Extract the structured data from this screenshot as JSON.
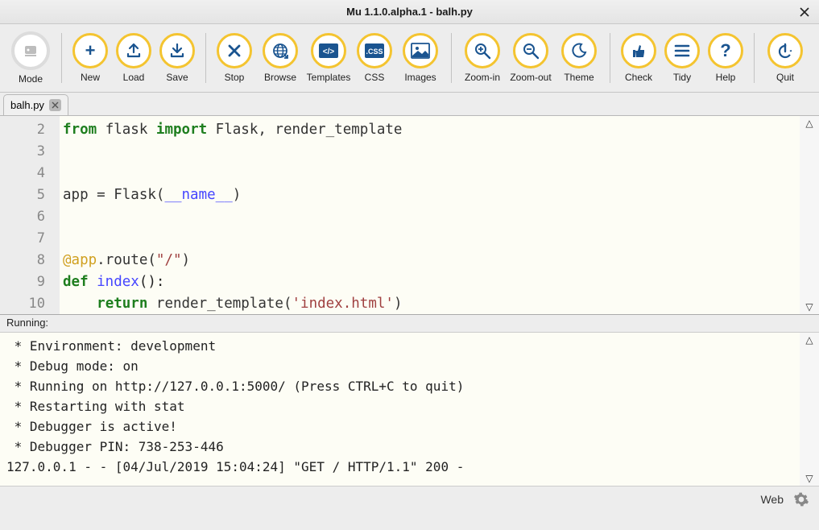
{
  "window": {
    "title": "Mu 1.1.0.alpha.1 - balh.py"
  },
  "toolbar": {
    "mode": "Mode",
    "new": "New",
    "load": "Load",
    "save": "Save",
    "stop": "Stop",
    "browse": "Browse",
    "templates": "Templates",
    "css": "CSS",
    "images": "Images",
    "zoomin": "Zoom-in",
    "zoomout": "Zoom-out",
    "theme": "Theme",
    "check": "Check",
    "tidy": "Tidy",
    "help": "Help",
    "quit": "Quit"
  },
  "tabs": [
    {
      "label": "balh.py"
    }
  ],
  "editor": {
    "line_numbers": [
      "2",
      "3",
      "4",
      "5",
      "6",
      "7",
      "8",
      "9",
      "10"
    ],
    "l2_from": "from",
    "l2_flask": " flask ",
    "l2_import": "import",
    "l2_rest": " Flask, render_template",
    "l5_app": "app = Flask(",
    "l5_name": "__name__",
    "l5_close": ")",
    "l8_deco": "@app",
    "l8_route": ".route(",
    "l8_str": "\"/\"",
    "l8_close": ")",
    "l9_def": "def",
    "l9_name": " index",
    "l9_paren": "():",
    "l10_indent": "    ",
    "l10_return": "return",
    "l10_call": " render_template(",
    "l10_str": "'index.html'",
    "l10_close": ")"
  },
  "panel": {
    "label": "Running:"
  },
  "console": {
    "l1": " * Environment: development",
    "l2": " * Debug mode: on",
    "l3": " * Running on http://127.0.0.1:5000/ (Press CTRL+C to quit)",
    "l4": " * Restarting with stat",
    "l5": " * Debugger is active!",
    "l6": " * Debugger PIN: 738-253-446",
    "l7": "127.0.0.1 - - [04/Jul/2019 15:04:24] \"GET / HTTP/1.1\" 200 -"
  },
  "status": {
    "mode": "Web"
  }
}
